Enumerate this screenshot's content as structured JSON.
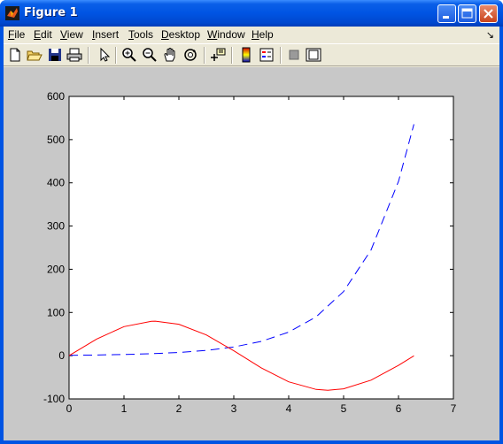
{
  "window": {
    "title": "Figure 1"
  },
  "menu": [
    "File",
    "Edit",
    "View",
    "Insert",
    "Tools",
    "Desktop",
    "Window",
    "Help"
  ],
  "menu_underline_index": [
    0,
    0,
    0,
    0,
    0,
    0,
    0,
    0
  ],
  "toolbar_icons": [
    "new-figure-icon",
    "open-file-icon",
    "save-icon",
    "print-icon",
    "select-arrow-icon",
    "zoom-in-icon",
    "zoom-out-icon",
    "pan-hand-icon",
    "rotate-3d-icon",
    "data-cursor-icon",
    "colorbar-icon",
    "legend-icon",
    "hide-plot-tools-icon",
    "show-plot-tools-icon"
  ],
  "colors": {
    "curve1": "#0000ff",
    "curve2": "#ff0000",
    "figure_bg": "#c8c8c8",
    "axes_bg": "#ffffff"
  },
  "chart_data": {
    "type": "line",
    "title": "",
    "xlabel": "",
    "ylabel": "",
    "xlim": [
      0,
      7
    ],
    "ylim": [
      -100,
      600
    ],
    "xticks": [
      "0",
      "1",
      "2",
      "3",
      "4",
      "5",
      "6",
      "7"
    ],
    "yticks": [
      "-100",
      "0",
      "100",
      "200",
      "300",
      "400",
      "500",
      "600"
    ],
    "grid": false,
    "series": [
      {
        "style": "dashed",
        "color": "#0000ff",
        "x": [
          0,
          0.5,
          1,
          1.5,
          2,
          2.5,
          3,
          3.5,
          4,
          4.5,
          5,
          5.5,
          6,
          6.28
        ],
        "y": [
          1,
          1.6,
          2.7,
          4.5,
          7.4,
          12.2,
          20.1,
          33.1,
          54.6,
          90,
          148.4,
          244.7,
          403.4,
          535.5
        ]
      },
      {
        "style": "solid",
        "color": "#ff0000",
        "x": [
          0,
          0.5,
          1,
          1.5,
          1.5708,
          2,
          2.5,
          3,
          3.5,
          4,
          4.5,
          4.7124,
          5,
          5.5,
          6,
          6.28
        ],
        "y": [
          0,
          38.4,
          67.3,
          79.8,
          80,
          72.7,
          47.9,
          11.3,
          -28.1,
          -60.5,
          -78.2,
          -80,
          -76.7,
          -56.6,
          -22.4,
          -0.3
        ]
      }
    ]
  }
}
